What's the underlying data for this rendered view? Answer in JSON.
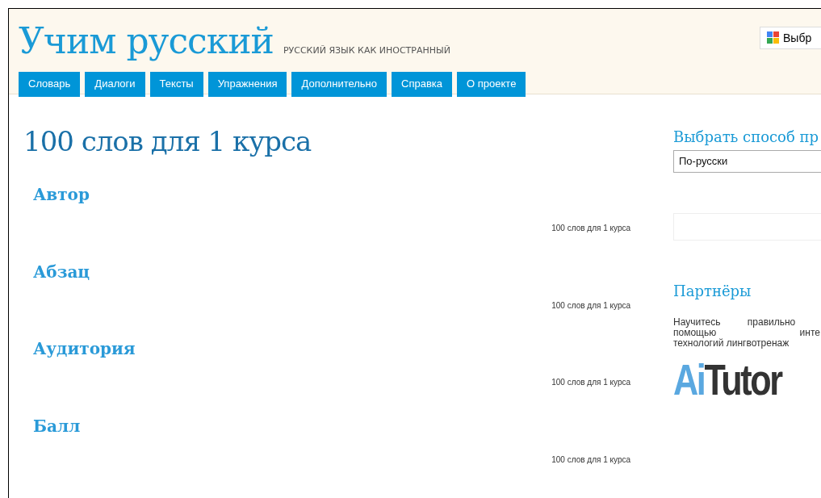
{
  "header": {
    "site_title": "Учим русский",
    "tagline": "РУССКИЙ ЯЗЫК КАК ИНОСТРАННЫЙ",
    "translate_label": "Выбр"
  },
  "nav": [
    {
      "label": "Словарь"
    },
    {
      "label": "Диалоги"
    },
    {
      "label": "Тексты"
    },
    {
      "label": "Упражнения"
    },
    {
      "label": "Дополнительно"
    },
    {
      "label": "Справка"
    },
    {
      "label": "О проекте"
    }
  ],
  "page_title": "100 слов для 1 курса",
  "entries": [
    {
      "title": "Автор",
      "category": "100 слов для 1 курса"
    },
    {
      "title": "Абзац",
      "category": "100 слов для 1 курса"
    },
    {
      "title": "Аудитория",
      "category": "100 слов для 1 курса"
    },
    {
      "title": "Балл",
      "category": "100 слов для 1 курса"
    }
  ],
  "sidebar": {
    "mode_heading": "Выбрать способ пр",
    "mode_value": "По-русски",
    "partners_heading": "Партнёры",
    "partners_lines": [
      "Научитесь правильно",
      "помощью инте",
      "технологий лингвотренаж"
    ],
    "logo_parts": [
      "Ai",
      "Tutor"
    ]
  }
}
